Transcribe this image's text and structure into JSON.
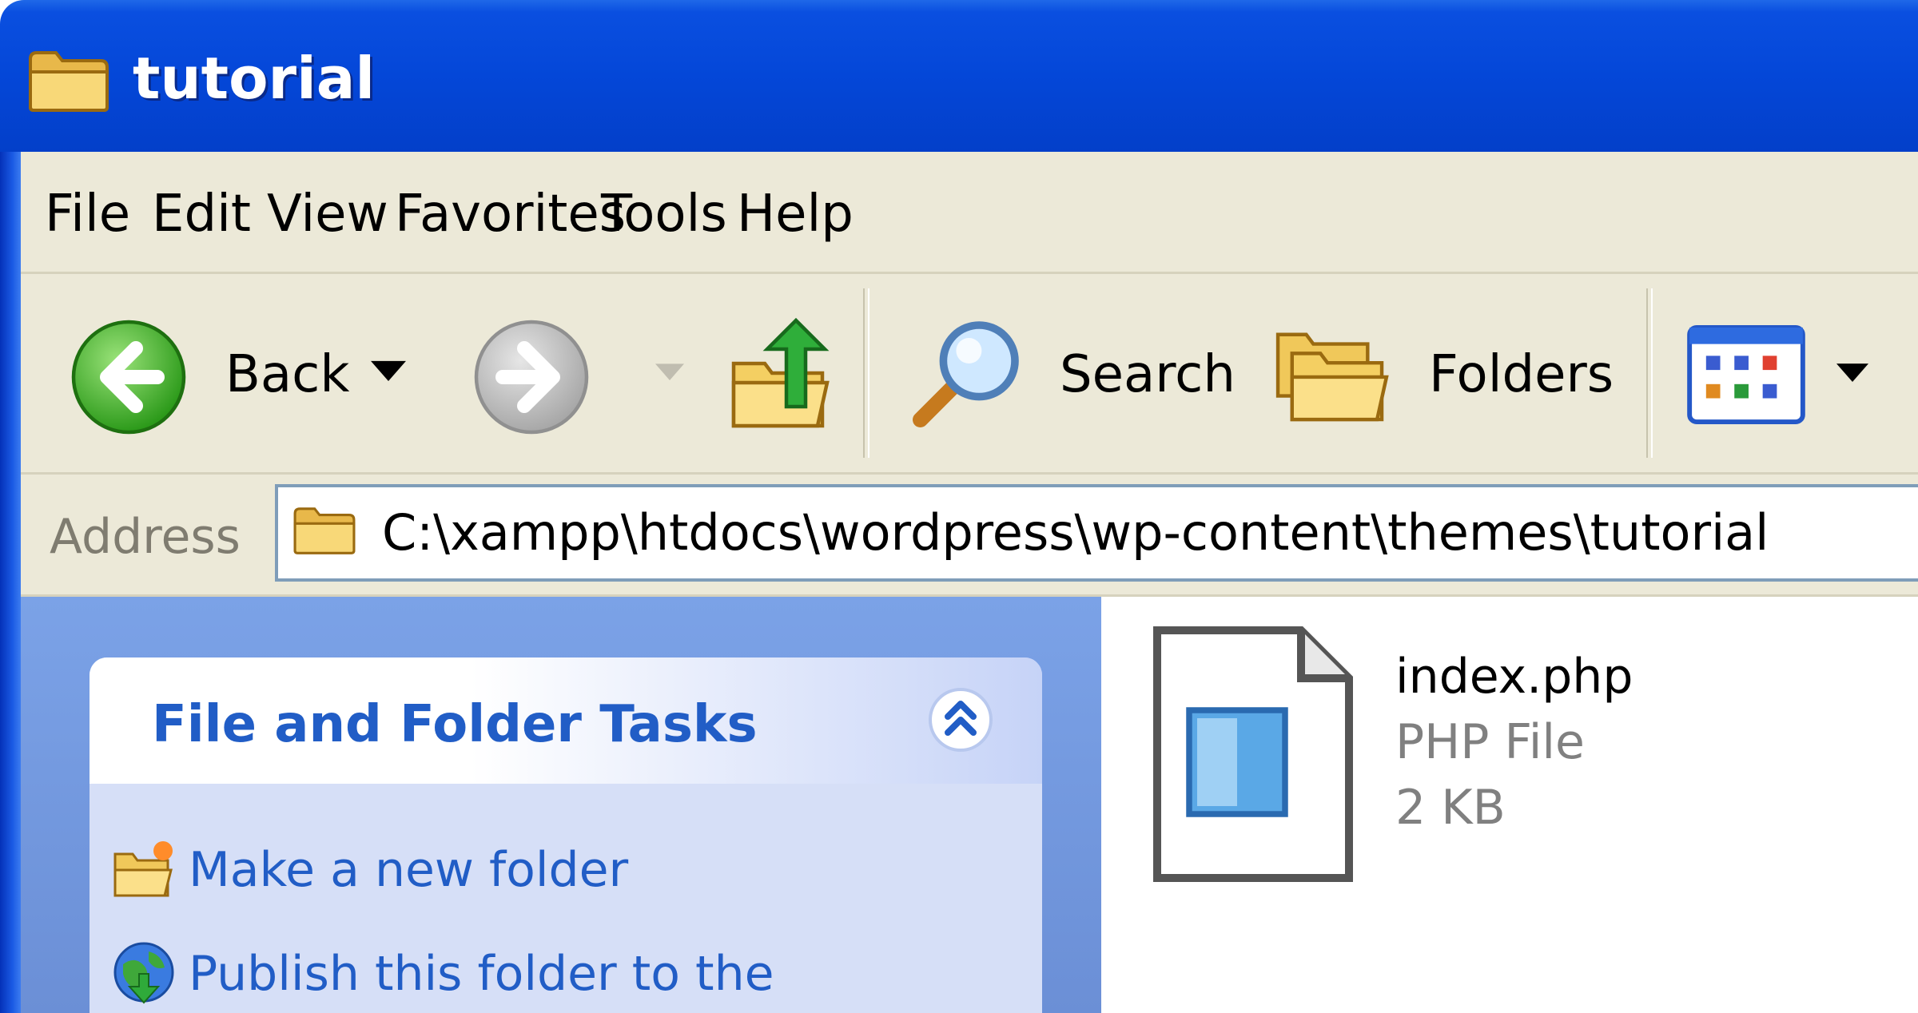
{
  "window": {
    "title": "tutorial"
  },
  "menu": {
    "items": [
      {
        "label": "File"
      },
      {
        "label": "Edit"
      },
      {
        "label": "View"
      },
      {
        "label": "Favorites"
      },
      {
        "label": "Tools"
      },
      {
        "label": "Help"
      }
    ]
  },
  "toolbar": {
    "back_label": "Back",
    "search_label": "Search",
    "folders_label": "Folders"
  },
  "address": {
    "label": "Address",
    "path": "C:\\xampp\\htdocs\\wordpress\\wp-content\\themes\\tutorial"
  },
  "task_pane": {
    "title": "File and Folder Tasks",
    "links": [
      {
        "label": "Make a new folder",
        "icon": "new-folder-icon"
      },
      {
        "label": "Publish this folder to the",
        "icon": "globe-icon"
      }
    ]
  },
  "files": [
    {
      "name": "index.php",
      "type": "PHP File",
      "size": "2 KB",
      "icon": "php-file-icon"
    }
  ],
  "colors": {
    "title_bar": "#0447d8",
    "chrome": "#ece9d8",
    "task_pane_bg": "#7ba2e7",
    "task_link": "#215dc6",
    "file_meta": "#808080"
  }
}
